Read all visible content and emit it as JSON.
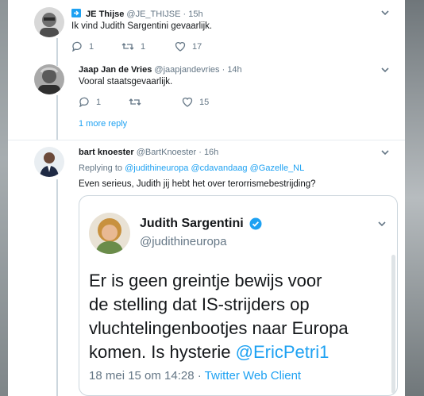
{
  "tweets": [
    {
      "author_name": "JE Thijse",
      "author_handle": "@JE_THIJSE",
      "sep": "·",
      "time": "15h",
      "text": "Ik vind Judith Sargentini gevaarlijk.",
      "replies": "1",
      "retweets": "1",
      "likes": "17"
    },
    {
      "author_name": "Jaap Jan de Vries",
      "author_handle": "@jaapjandevries",
      "sep": "·",
      "time": "14h",
      "text": "Vooral staatsgevaarlijk.",
      "replies": "1",
      "retweets": "",
      "likes": "15"
    },
    {
      "author_name": "bart knoester",
      "author_handle": "@BartKnoester",
      "sep": "·",
      "time": "16h",
      "replying_prefix": "Replying to",
      "replying_handles": "@judithineuropa @cdavandaag @Gazelle_NL",
      "text": "Even serieus, Judith jij hebt het over terorrismebestrijding?"
    }
  ],
  "more_reply": "1 more reply",
  "quoted": {
    "author_name": "Judith Sargentini",
    "author_handle": "@judithineuropa",
    "body_lines": [
      "Er is geen greintje bewijs voor",
      "de stelling dat IS-strijders op",
      "vluchtelingenbootjes naar Europa",
      "komen. Is hysterie"
    ],
    "mention": "@EricPetri1",
    "date": "18 mei 15 om 14:28",
    "dot": "·",
    "client": "Twitter Web Client"
  },
  "colors": {
    "accent": "#1da1f2",
    "muted": "#657786",
    "verified": "#1da1f2",
    "thread_line": "#ccd6dd"
  },
  "icons": [
    "reply-icon",
    "retweet-icon",
    "like-icon",
    "chevron-down-icon",
    "verified-badge-icon",
    "tweetshift-icon"
  ]
}
